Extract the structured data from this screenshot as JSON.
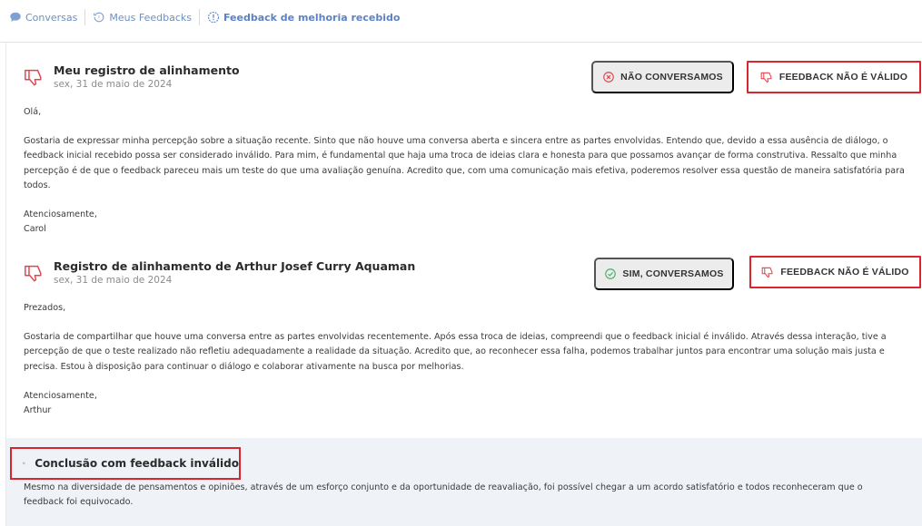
{
  "breadcrumb": {
    "items": [
      {
        "label": "Conversas",
        "icon": "chat-bubble-icon"
      },
      {
        "label": "Meus Feedbacks",
        "icon": "history-icon"
      },
      {
        "label": "Feedback de melhoria recebido",
        "icon": "alert-circle-icon"
      }
    ]
  },
  "colors": {
    "accent": "#5b82c4",
    "danger": "#e0454f",
    "highlight_border": "#d8262f",
    "pill_bg": "#ececec",
    "conclusion_bg": "#eff2f7"
  },
  "feedbacks": [
    {
      "title": "Meu registro de alinhamento",
      "date": "sex, 31 de maio de 2024",
      "status_label": "NÃO CONVERSAMOS",
      "status_icon": "x-circle-icon",
      "invalid_label": "FEEDBACK NÃO É VÁLIDO",
      "greeting": "Olá,",
      "body_lines": [
        "Gostaria de expressar minha percepção sobre a situação recente. Sinto que não houve uma conversa aberta e sincera entre as partes envolvidas. Entendo que, devido a essa ausência de diálogo, o",
        "feedback inicial recebido possa ser considerado inválido. Para mim, é fundamental que haja uma troca de ideias clara e honesta para que possamos avançar de forma construtiva. Ressalto que minha",
        "percepção é de que o feedback pareceu mais um teste do que uma avaliação genuína. Acredito que, com uma comunicação mais efetiva, poderemos resolver essa questão de maneira satisfatória para",
        "todos."
      ],
      "closing": "Atenciosamente,",
      "signature": "Carol"
    },
    {
      "title": "Registro de alinhamento de Arthur Josef Curry Aquaman",
      "date": "sex, 31 de maio de 2024",
      "status_label": "SIM, CONVERSAMOS",
      "status_icon": "check-circle-icon",
      "invalid_label": "FEEDBACK NÃO É VÁLIDO",
      "greeting": "Prezados,",
      "body_lines": [
        "Gostaria de compartilhar que houve uma conversa entre as partes envolvidas recentemente. Após essa troca de ideias, compreendi que o feedback inicial é inválido. Através dessa interação, tive a",
        "percepção de que o teste realizado não refletiu adequadamente a realidade da situação. Acredito que, ao reconhecer essa falha, podemos trabalhar juntos para encontrar uma solução mais justa e",
        "precisa. Estou à disposição para continuar o diálogo e colaborar ativamente na busca por melhorias."
      ],
      "closing": "Atenciosamente,",
      "signature": "Arthur"
    }
  ],
  "conclusion": {
    "title": "Conclusão com feedback inválido",
    "lines": [
      "Mesmo na diversidade de pensamentos e opiniões, através de um esforço conjunto e da oportunidade de reavaliação, foi possível chegar a um acordo satisfatório e todos reconheceram que o",
      "feedback foi equivocado."
    ]
  }
}
